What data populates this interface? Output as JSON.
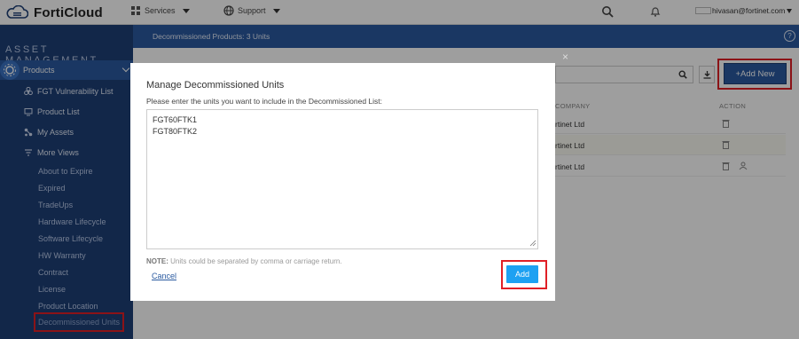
{
  "header": {
    "brand": "FortiCloud",
    "nav": [
      {
        "label": "Services",
        "icon": "services-icon"
      },
      {
        "label": "Support",
        "icon": "globe-icon"
      }
    ],
    "icons": [
      "search-icon",
      "bell-icon"
    ],
    "user_email": "hivasan@fortinet.com"
  },
  "sidebar": {
    "section_title": "ASSET MANAGEMENT",
    "group_label": "Products",
    "items": [
      {
        "label": "FGT Vulnerability List",
        "icon": "biohazard-icon"
      },
      {
        "label": "Product List",
        "icon": "monitor-icon"
      },
      {
        "label": "My Assets",
        "icon": "network-icon"
      },
      {
        "label": "More Views",
        "icon": "filter-icon"
      }
    ],
    "subitems": [
      "About to Expire",
      "Expired",
      "TradeUps",
      "Hardware Lifecycle",
      "Software Lifecycle",
      "HW Warranty",
      "Contract",
      "License",
      "Product Location",
      "Decommissioned Units"
    ]
  },
  "main": {
    "breadcrumb": "Decommissioned Products: 3 Units",
    "help_label": "?",
    "add_new_label": "+Add New",
    "columns": [
      "COMPANY",
      "ACTION"
    ],
    "rows": [
      {
        "company": "rtinet Ltd"
      },
      {
        "company": "rtinet Ltd"
      },
      {
        "company": "rtinet Ltd"
      }
    ]
  },
  "modal": {
    "title": "Manage Decommissioned Units",
    "instruction": "Please enter the units you want to include in the Decommissioned List:",
    "textarea_value": "FGT60FTK1\nFGT80FTK2",
    "note_label": "NOTE:",
    "note_text": " Units could be separated by comma or carriage return.",
    "cancel_label": "Cancel",
    "add_label": "Add",
    "close_glyph": "×"
  },
  "colors": {
    "sidebar_bg": "#1e3f77",
    "accent_blue": "#2a5aa0",
    "add_button": "#1da1f2",
    "highlight_red": "#e01f26"
  }
}
